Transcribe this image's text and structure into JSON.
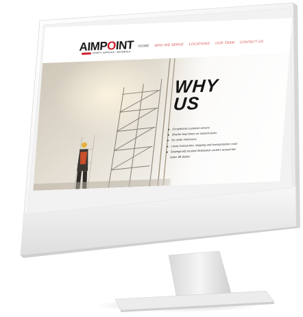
{
  "site": {
    "logo": {
      "text_before": "AIMP",
      "text_mark": "O",
      "text_after": "INT",
      "tagline": "SAFETY SUPPLIES • MATERIALS"
    },
    "nav": [
      {
        "label": "HOME",
        "active": true
      },
      {
        "label": "WHO WE SERVE",
        "active": false
      },
      {
        "label": "LOCATIONS",
        "active": false
      },
      {
        "label": "OUR TEAM",
        "active": false
      },
      {
        "label": "CONTACT US",
        "active": false
      }
    ],
    "hero": {
      "title_line1": "WHY",
      "title_line2": "US",
      "bullets": [
        "Exceptional customer service",
        "Shorter lead times on restock items",
        "No order minimums",
        "Lower transaction, shipping and transportation costs",
        "Strategically located distribution centers around the",
        "lower 48 States"
      ]
    }
  },
  "colors": {
    "brand_red": "#cc1f2b",
    "nav_red": "#d64c4c",
    "monitor_white": "#f4f4f4"
  }
}
